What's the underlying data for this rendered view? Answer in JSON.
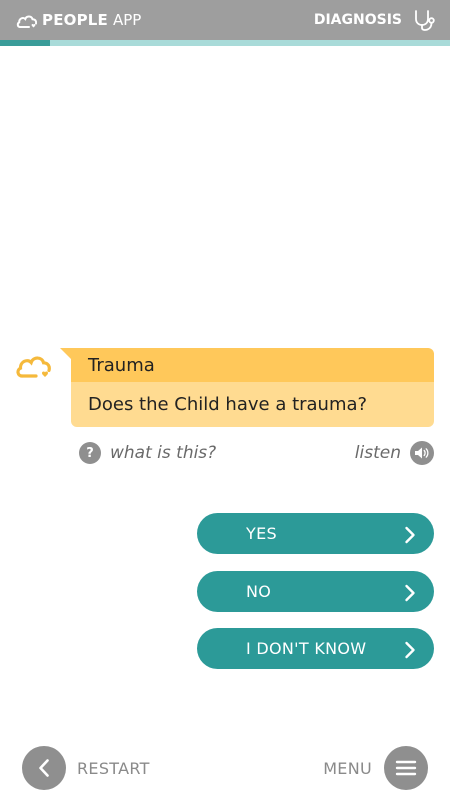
{
  "header": {
    "brand_bold": "PEOPLE",
    "brand_light": "APP",
    "section_label": "DIAGNOSIS",
    "icons": {
      "brand": "cloud-heart-icon",
      "section": "stethoscope-icon"
    },
    "colors": {
      "bar": "#9e9e9e",
      "text": "#ffffff"
    }
  },
  "progress": {
    "value": 0.11,
    "fill_color": "#3a9c99",
    "track_color": "#a9dbd9"
  },
  "question": {
    "avatar_icon": "cloud-heart-icon",
    "title": "Trauma",
    "text": "Does the Child have a trauma?",
    "colors": {
      "title_bg": "#ffc85a",
      "body_bg": "#ffdb91",
      "avatar": "#f5b93b"
    }
  },
  "help": {
    "icon": "question-icon",
    "icon_glyph": "?",
    "label": "what is this?"
  },
  "listen": {
    "label": "listen",
    "icon": "speaker-icon"
  },
  "answers": [
    {
      "label": "YES",
      "icon": "chevron-right-icon"
    },
    {
      "label": "NO",
      "icon": "chevron-right-icon"
    },
    {
      "label": "I DON'T KNOW",
      "icon": "chevron-right-icon"
    }
  ],
  "answer_color": "#2c9a98",
  "nav": {
    "restart_label": "RESTART",
    "restart_icon": "chevron-left-icon",
    "menu_label": "MENU",
    "menu_icon": "hamburger-menu-icon"
  }
}
